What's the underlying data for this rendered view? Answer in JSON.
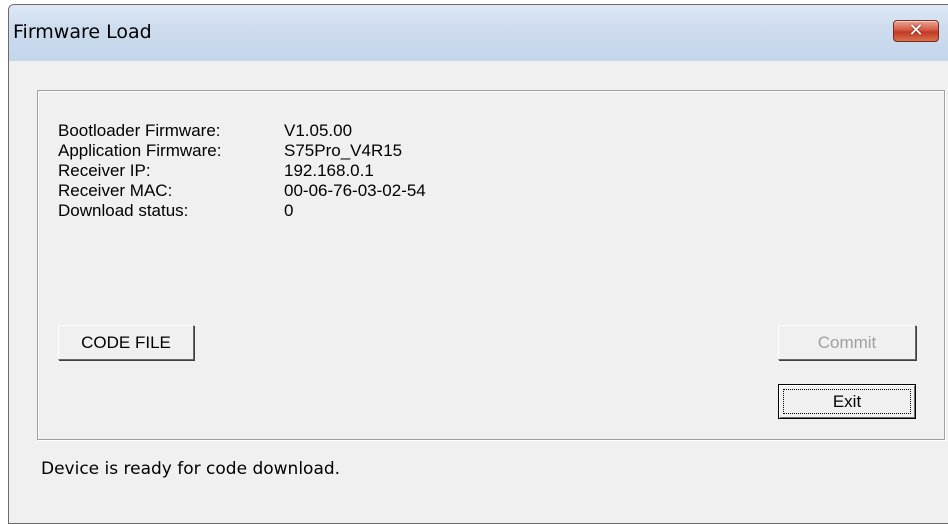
{
  "window": {
    "title": "Firmware Load",
    "close_glyph": "✕"
  },
  "info": [
    {
      "label": "Bootloader Firmware:",
      "value": "V1.05.00"
    },
    {
      "label": "Application Firmware:",
      "value": "S75Pro_V4R15"
    },
    {
      "label": "Receiver IP:",
      "value": "192.168.0.1"
    },
    {
      "label": "Receiver MAC:",
      "value": "00-06-76-03-02-54"
    },
    {
      "label": "Download status:",
      "value": "0"
    }
  ],
  "buttons": {
    "code_file": "CODE FILE",
    "commit": "Commit",
    "exit": "Exit"
  },
  "status_message": "Device is ready for code download.",
  "colors": {
    "titlebar": "#c4d5ea",
    "close_button": "#c23a22",
    "window_background": "#f0f0f0",
    "disabled_text": "#a0a0a0"
  }
}
